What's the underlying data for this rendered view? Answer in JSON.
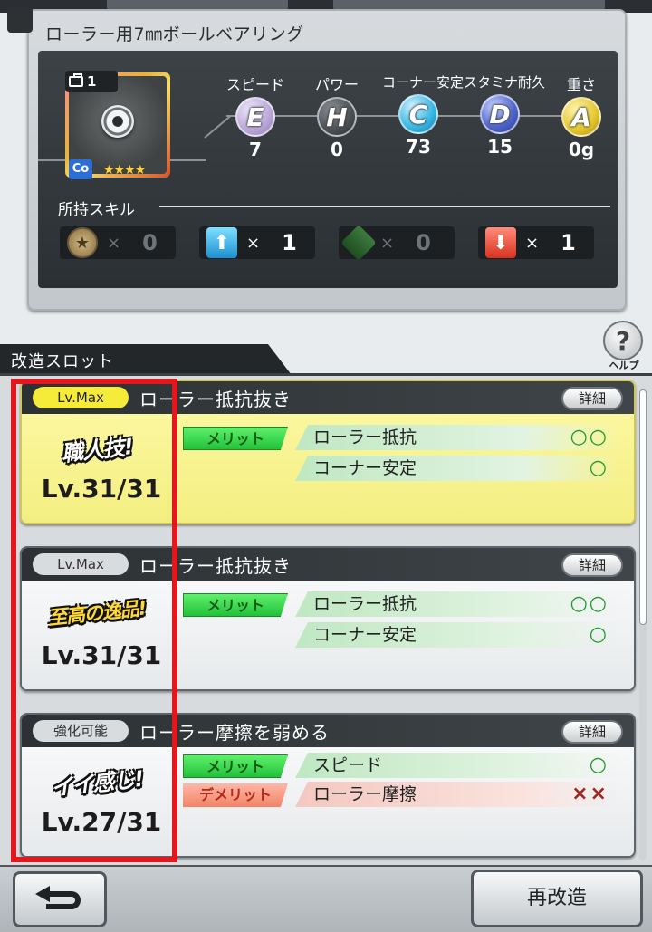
{
  "part": {
    "title": "ローラー用7㎜ボールベアリング",
    "count": "1",
    "type_badge": "Co",
    "rarity": "★★★★",
    "icon": "ball-bearing-icon"
  },
  "stats": [
    {
      "label": "スピード",
      "grade": "E",
      "value": "7",
      "color": "#b9a7d8"
    },
    {
      "label": "パワー",
      "grade": "H",
      "value": "0",
      "color": "#4b4f53"
    },
    {
      "label": "コーナー安定",
      "grade": "C",
      "value": "73",
      "color": "#36b6e2"
    },
    {
      "label": "スタミナ耐久",
      "grade": "D",
      "value": "15",
      "color": "#4b63c9"
    },
    {
      "label": "重さ",
      "grade": "A",
      "value": "0g",
      "color": "#e3c62b"
    }
  ],
  "skills": {
    "heading": "所持スキル",
    "items": [
      {
        "icon": "star-skill-icon",
        "x": "×",
        "count": "0"
      },
      {
        "icon": "up-arrow-skill-icon",
        "x": "×",
        "count": "1"
      },
      {
        "icon": "diamond-skill-icon",
        "x": "×",
        "count": "0"
      },
      {
        "icon": "down-arrow-skill-icon",
        "x": "×",
        "count": "1"
      }
    ]
  },
  "slots_header": "改造スロット",
  "help": {
    "glyph": "?",
    "label": "ヘルプ"
  },
  "detail_label": "詳細",
  "merit_label": "メリット",
  "demerit_label": "デメリット",
  "slots": [
    {
      "tag": "Lv.Max",
      "name": "ローラー抵抗抜き",
      "rank": "職人技!",
      "level": "Lv.31/31",
      "effects": [
        {
          "kind": "merit",
          "text": "ローラー抵抗",
          "mark": "○○"
        },
        {
          "kind": "merit",
          "text": "コーナー安定",
          "mark": "○"
        }
      ]
    },
    {
      "tag": "Lv.Max",
      "name": "ローラー抵抗抜き",
      "rank": "至高の逸品!",
      "level": "Lv.31/31",
      "effects": [
        {
          "kind": "merit",
          "text": "ローラー抵抗",
          "mark": "○○"
        },
        {
          "kind": "merit",
          "text": "コーナー安定",
          "mark": "○"
        }
      ]
    },
    {
      "tag": "強化可能",
      "name": "ローラー摩擦を弱める",
      "rank": "イイ感じ!",
      "level": "Lv.27/31",
      "effects": [
        {
          "kind": "merit",
          "text": "スピード",
          "mark": "○"
        },
        {
          "kind": "demerit",
          "text": "ローラー摩擦",
          "mark": "××"
        }
      ]
    }
  ],
  "footer": {
    "back_icon": "back-arrow-icon",
    "remodel_label": "再改造"
  }
}
